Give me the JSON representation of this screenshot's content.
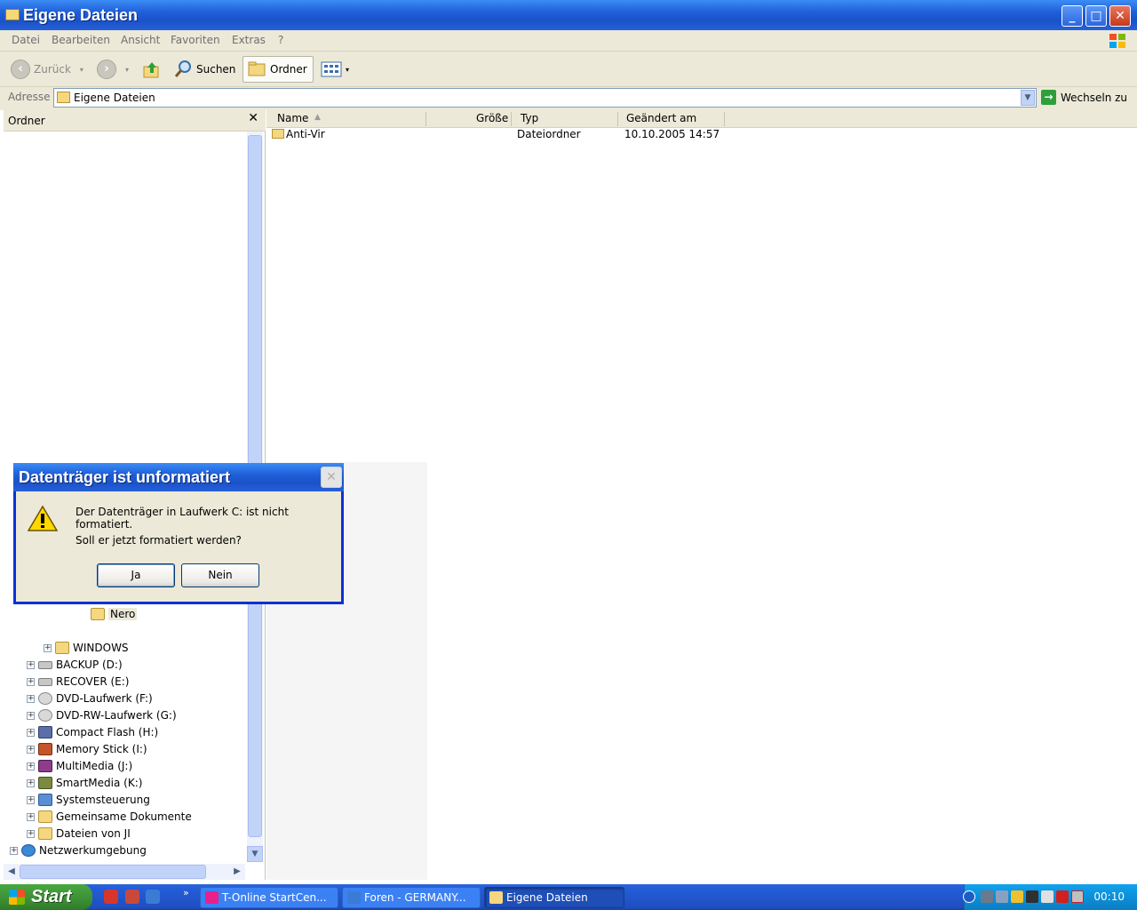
{
  "window": {
    "title": "Eigene Dateien",
    "controls": {
      "minimize": "_",
      "maximize": "□",
      "close": "✕"
    }
  },
  "menu": [
    "Datei",
    "Bearbeiten",
    "Ansicht",
    "Favoriten",
    "Extras",
    "?"
  ],
  "toolbar": {
    "back_label": "Zurück",
    "search_label": "Suchen",
    "folders_label": "Ordner"
  },
  "address": {
    "label": "Adresse",
    "value": "Eigene Dateien",
    "go_label": "Wechseln zu"
  },
  "folder_pane": {
    "title": "Ordner",
    "close": "✕",
    "tree": [
      {
        "label": "Nero",
        "icon": "folder-icon",
        "expander": false
      },
      {
        "label": "WINDOWS",
        "icon": "folder-icon",
        "expander": true
      },
      {
        "label": "BACKUP (D:)",
        "icon": "drive-icon",
        "expander": true
      },
      {
        "label": "RECOVER (E:)",
        "icon": "drive-icon",
        "expander": true
      },
      {
        "label": "DVD-Laufwerk (F:)",
        "icon": "cd-drive-icon",
        "expander": true
      },
      {
        "label": "DVD-RW-Laufwerk (G:)",
        "icon": "cd-drive-icon",
        "expander": true
      },
      {
        "label": "Compact Flash (H:)",
        "icon": "compact-flash-icon",
        "expander": true
      },
      {
        "label": "Memory Stick (I:)",
        "icon": "memory-stick-icon",
        "expander": true
      },
      {
        "label": "MultiMedia (J:)",
        "icon": "multimedia-card-icon",
        "expander": true
      },
      {
        "label": "SmartMedia (K:)",
        "icon": "smartmedia-icon",
        "expander": true
      },
      {
        "label": "Systemsteuerung",
        "icon": "control-panel-icon",
        "expander": true
      },
      {
        "label": "Gemeinsame Dokumente",
        "icon": "folder-icon",
        "expander": true
      },
      {
        "label": "Dateien von JI",
        "icon": "folder-icon",
        "expander": true
      },
      {
        "label": "Netzwerkumgebung",
        "icon": "network-icon",
        "expander": true
      }
    ]
  },
  "file_list": {
    "columns": [
      "Name",
      "Größe",
      "Typ",
      "Geändert am"
    ],
    "rows": [
      {
        "name": "Anti-Vir",
        "size": "",
        "type": "Dateiordner",
        "modified": "10.10.2005 14:57"
      }
    ]
  },
  "dialog": {
    "title": "Datenträger ist unformatiert",
    "message1": "Der Datenträger in Laufwerk C: ist nicht formatiert.",
    "message2": "Soll er jetzt formatiert werden?",
    "yes_label": "Ja",
    "no_label": "Nein",
    "close": "✕"
  },
  "taskbar": {
    "start_label": "Start",
    "more": "»",
    "tasks": [
      "T-Online StartCen...",
      "Foren - GERMANY...",
      "Eigene Dateien"
    ],
    "clock": "00:10"
  },
  "colors": {
    "title_blue": "#1f5fd8",
    "face": "#ece9d8",
    "start_green": "#3c8f35",
    "tray_blue": "#0c8fd9"
  }
}
